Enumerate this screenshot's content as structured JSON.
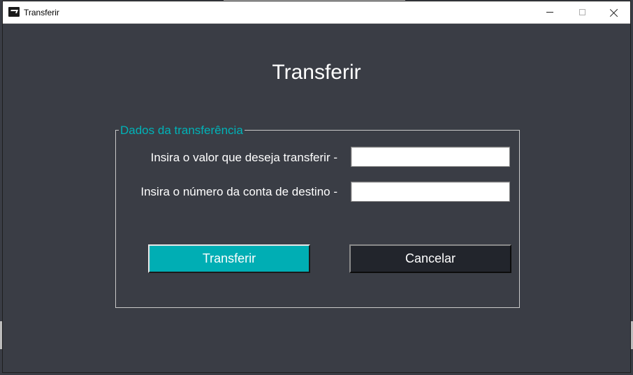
{
  "window": {
    "title": "Transferir",
    "icon": "app-icon",
    "controls": [
      "minimize-icon",
      "maximize-icon",
      "close-icon"
    ]
  },
  "page": {
    "heading": "Transferir"
  },
  "form": {
    "legend": "Dados da transferência",
    "valor_label": "Insira o valor que deseja transferir -",
    "valor_value": "",
    "conta_label": "Insira o número da conta de destino -",
    "conta_value": ""
  },
  "actions": {
    "transfer_label": "Transferir",
    "cancel_label": "Cancelar"
  },
  "colors": {
    "background": "#3a3d45",
    "accent": "#00aeb4",
    "legend_text": "#00b3b8",
    "cancel_button": "#22252c",
    "text": "#ffffff"
  }
}
